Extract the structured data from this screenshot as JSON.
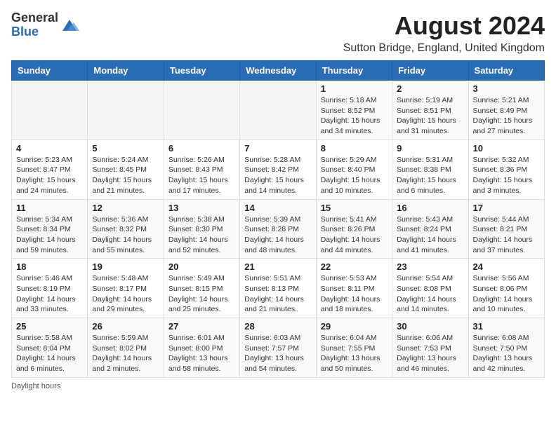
{
  "header": {
    "logo_general": "General",
    "logo_blue": "Blue",
    "month_year": "August 2024",
    "location": "Sutton Bridge, England, United Kingdom"
  },
  "days_of_week": [
    "Sunday",
    "Monday",
    "Tuesday",
    "Wednesday",
    "Thursday",
    "Friday",
    "Saturday"
  ],
  "weeks": [
    [
      {
        "day": "",
        "info": ""
      },
      {
        "day": "",
        "info": ""
      },
      {
        "day": "",
        "info": ""
      },
      {
        "day": "",
        "info": ""
      },
      {
        "day": "1",
        "info": "Sunrise: 5:18 AM\nSunset: 8:52 PM\nDaylight: 15 hours\nand 34 minutes."
      },
      {
        "day": "2",
        "info": "Sunrise: 5:19 AM\nSunset: 8:51 PM\nDaylight: 15 hours\nand 31 minutes."
      },
      {
        "day": "3",
        "info": "Sunrise: 5:21 AM\nSunset: 8:49 PM\nDaylight: 15 hours\nand 27 minutes."
      }
    ],
    [
      {
        "day": "4",
        "info": "Sunrise: 5:23 AM\nSunset: 8:47 PM\nDaylight: 15 hours\nand 24 minutes."
      },
      {
        "day": "5",
        "info": "Sunrise: 5:24 AM\nSunset: 8:45 PM\nDaylight: 15 hours\nand 21 minutes."
      },
      {
        "day": "6",
        "info": "Sunrise: 5:26 AM\nSunset: 8:43 PM\nDaylight: 15 hours\nand 17 minutes."
      },
      {
        "day": "7",
        "info": "Sunrise: 5:28 AM\nSunset: 8:42 PM\nDaylight: 15 hours\nand 14 minutes."
      },
      {
        "day": "8",
        "info": "Sunrise: 5:29 AM\nSunset: 8:40 PM\nDaylight: 15 hours\nand 10 minutes."
      },
      {
        "day": "9",
        "info": "Sunrise: 5:31 AM\nSunset: 8:38 PM\nDaylight: 15 hours\nand 6 minutes."
      },
      {
        "day": "10",
        "info": "Sunrise: 5:32 AM\nSunset: 8:36 PM\nDaylight: 15 hours\nand 3 minutes."
      }
    ],
    [
      {
        "day": "11",
        "info": "Sunrise: 5:34 AM\nSunset: 8:34 PM\nDaylight: 14 hours\nand 59 minutes."
      },
      {
        "day": "12",
        "info": "Sunrise: 5:36 AM\nSunset: 8:32 PM\nDaylight: 14 hours\nand 55 minutes."
      },
      {
        "day": "13",
        "info": "Sunrise: 5:38 AM\nSunset: 8:30 PM\nDaylight: 14 hours\nand 52 minutes."
      },
      {
        "day": "14",
        "info": "Sunrise: 5:39 AM\nSunset: 8:28 PM\nDaylight: 14 hours\nand 48 minutes."
      },
      {
        "day": "15",
        "info": "Sunrise: 5:41 AM\nSunset: 8:26 PM\nDaylight: 14 hours\nand 44 minutes."
      },
      {
        "day": "16",
        "info": "Sunrise: 5:43 AM\nSunset: 8:24 PM\nDaylight: 14 hours\nand 41 minutes."
      },
      {
        "day": "17",
        "info": "Sunrise: 5:44 AM\nSunset: 8:21 PM\nDaylight: 14 hours\nand 37 minutes."
      }
    ],
    [
      {
        "day": "18",
        "info": "Sunrise: 5:46 AM\nSunset: 8:19 PM\nDaylight: 14 hours\nand 33 minutes."
      },
      {
        "day": "19",
        "info": "Sunrise: 5:48 AM\nSunset: 8:17 PM\nDaylight: 14 hours\nand 29 minutes."
      },
      {
        "day": "20",
        "info": "Sunrise: 5:49 AM\nSunset: 8:15 PM\nDaylight: 14 hours\nand 25 minutes."
      },
      {
        "day": "21",
        "info": "Sunrise: 5:51 AM\nSunset: 8:13 PM\nDaylight: 14 hours\nand 21 minutes."
      },
      {
        "day": "22",
        "info": "Sunrise: 5:53 AM\nSunset: 8:11 PM\nDaylight: 14 hours\nand 18 minutes."
      },
      {
        "day": "23",
        "info": "Sunrise: 5:54 AM\nSunset: 8:08 PM\nDaylight: 14 hours\nand 14 minutes."
      },
      {
        "day": "24",
        "info": "Sunrise: 5:56 AM\nSunset: 8:06 PM\nDaylight: 14 hours\nand 10 minutes."
      }
    ],
    [
      {
        "day": "25",
        "info": "Sunrise: 5:58 AM\nSunset: 8:04 PM\nDaylight: 14 hours\nand 6 minutes."
      },
      {
        "day": "26",
        "info": "Sunrise: 5:59 AM\nSunset: 8:02 PM\nDaylight: 14 hours\nand 2 minutes."
      },
      {
        "day": "27",
        "info": "Sunrise: 6:01 AM\nSunset: 8:00 PM\nDaylight: 13 hours\nand 58 minutes."
      },
      {
        "day": "28",
        "info": "Sunrise: 6:03 AM\nSunset: 7:57 PM\nDaylight: 13 hours\nand 54 minutes."
      },
      {
        "day": "29",
        "info": "Sunrise: 6:04 AM\nSunset: 7:55 PM\nDaylight: 13 hours\nand 50 minutes."
      },
      {
        "day": "30",
        "info": "Sunrise: 6:06 AM\nSunset: 7:53 PM\nDaylight: 13 hours\nand 46 minutes."
      },
      {
        "day": "31",
        "info": "Sunrise: 6:08 AM\nSunset: 7:50 PM\nDaylight: 13 hours\nand 42 minutes."
      }
    ]
  ],
  "footer": {
    "daylight_hours": "Daylight hours"
  }
}
